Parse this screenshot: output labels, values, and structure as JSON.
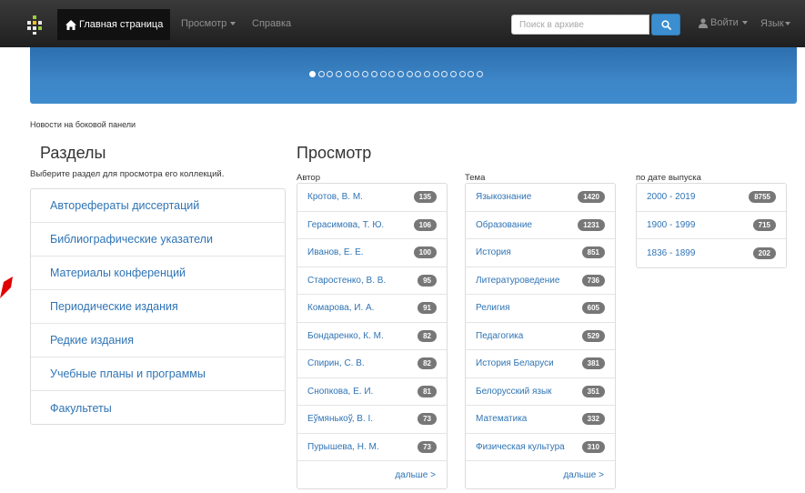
{
  "navbar": {
    "home_label": "Главная страница",
    "browse_label": "Просмотр",
    "help_label": "Справка",
    "search_placeholder": "Поиск в архиве",
    "login_label": "Войти",
    "language_label": "Язык"
  },
  "banner": {
    "slide_count": 20,
    "active_slide": 1
  },
  "news_label": "Новости на боковой панели",
  "sections": {
    "title": "Разделы",
    "subtitle": "Выберите раздел для просмотра его коллекций.",
    "items": [
      "Авторефераты диссертаций",
      "Библиографические указатели",
      "Материалы конференций",
      "Периодические издания",
      "Редкие издания",
      "Учебные планы и программы",
      "Факультеты"
    ]
  },
  "browse": {
    "title": "Просмотр",
    "author": {
      "title": "Автор",
      "items": [
        {
          "label": "Кротов, В. М.",
          "count": "135"
        },
        {
          "label": "Герасимова, Т. Ю.",
          "count": "106"
        },
        {
          "label": "Иванов, Е. Е.",
          "count": "100"
        },
        {
          "label": "Старостенко, В. В.",
          "count": "95"
        },
        {
          "label": "Комарова, И. А.",
          "count": "91"
        },
        {
          "label": "Бондаренко, К. М.",
          "count": "82"
        },
        {
          "label": "Спирин, С. В.",
          "count": "82"
        },
        {
          "label": "Снопкова, Е. И.",
          "count": "81"
        },
        {
          "label": "Еўмянькоў, В. І.",
          "count": "73"
        },
        {
          "label": "Пурышева, Н. М.",
          "count": "73"
        }
      ],
      "more": "дальше >"
    },
    "subject": {
      "title": "Тема",
      "items": [
        {
          "label": "Языкознание",
          "count": "1420"
        },
        {
          "label": "Образование",
          "count": "1231"
        },
        {
          "label": "История",
          "count": "851"
        },
        {
          "label": "Литературоведение",
          "count": "736"
        },
        {
          "label": "Религия",
          "count": "605"
        },
        {
          "label": "Педагогика",
          "count": "529"
        },
        {
          "label": "История Беларуси",
          "count": "381"
        },
        {
          "label": "Белорусский язык",
          "count": "351"
        },
        {
          "label": "Математика",
          "count": "332"
        },
        {
          "label": "Физическая культура",
          "count": "310"
        }
      ],
      "more": "дальше >"
    },
    "date": {
      "title": "по дате выпуска",
      "items": [
        {
          "label": "2000 - 2019",
          "count": "8755"
        },
        {
          "label": "1900 - 1999",
          "count": "715"
        },
        {
          "label": "1836 - 1899",
          "count": "202"
        }
      ]
    }
  },
  "colors": {
    "navbar": "#262626",
    "banner": "#3a82c4",
    "link": "#2f74b5",
    "badge": "#777777",
    "search_button": "#3b8fd0",
    "annotation_arrow": "#e00000"
  },
  "icons": {
    "logo": "grid-logo-icon",
    "home": "home-icon",
    "search": "search-icon",
    "user": "user-icon"
  }
}
